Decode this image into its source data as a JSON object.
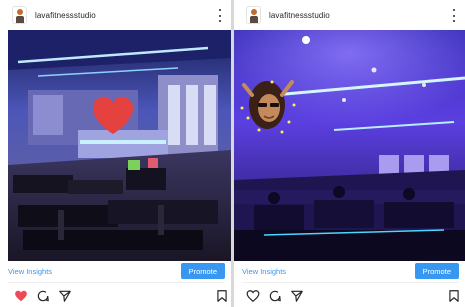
{
  "posts": [
    {
      "username": "lavafitnessstudio",
      "view_insights_label": "View Insights",
      "promote_label": "Promote",
      "liked": true,
      "sticker": "heart-sticker",
      "icons": [
        "heart-icon",
        "comment-icon",
        "share-icon",
        "bookmark-icon"
      ]
    },
    {
      "username": "lavafitnessstudio",
      "view_insights_label": "View Insights",
      "promote_label": "Promote",
      "liked": false,
      "sticker": "person-sticker",
      "icons": [
        "heart-icon",
        "comment-icon",
        "share-icon",
        "bookmark-icon"
      ]
    }
  ],
  "colors": {
    "link_blue": "#3897f0",
    "like_red": "#ed4956",
    "text_dark": "#262626"
  }
}
